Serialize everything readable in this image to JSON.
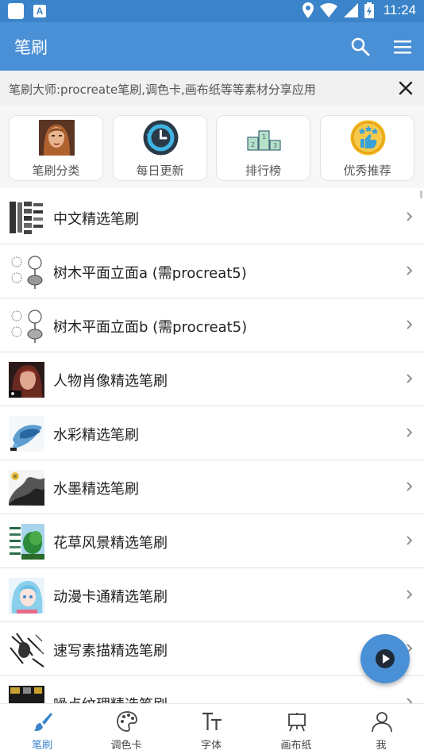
{
  "status_bar": {
    "time": "11:24"
  },
  "app_bar": {
    "title": "笔刷"
  },
  "notice": {
    "text": "笔刷大师:procreate笔刷,调色卡,画布纸等等素材分享应用"
  },
  "categories": [
    {
      "label": "笔刷分类",
      "icon": "portrait-icon"
    },
    {
      "label": "每日更新",
      "icon": "clock-update-icon"
    },
    {
      "label": "排行榜",
      "icon": "podium-icon"
    },
    {
      "label": "优秀推荐",
      "icon": "thumbs-up-stars-icon"
    }
  ],
  "list": [
    {
      "label": "中文精选笔刷",
      "thumb": "brush-strokes-thumb"
    },
    {
      "label": "树木平面立面a (需procreat5)",
      "thumb": "tree-thumb"
    },
    {
      "label": "树木平面立面b (需procreat5)",
      "thumb": "tree-thumb"
    },
    {
      "label": "人物肖像精选笔刷",
      "thumb": "portrait-thumb"
    },
    {
      "label": "水彩精选笔刷",
      "thumb": "watercolor-thumb"
    },
    {
      "label": "水墨精选笔刷",
      "thumb": "ink-wash-thumb"
    },
    {
      "label": "花草风景精选笔刷",
      "thumb": "landscape-thumb"
    },
    {
      "label": "动漫卡通精选笔刷",
      "thumb": "anime-thumb"
    },
    {
      "label": "速写素描精选笔刷",
      "thumb": "sketch-thumb"
    },
    {
      "label": "噪点纹理精选笔刷",
      "thumb": "noise-texture-thumb"
    }
  ],
  "tabs": [
    {
      "label": "笔刷",
      "icon": "brush-icon",
      "active": true
    },
    {
      "label": "调色卡",
      "icon": "palette-icon",
      "active": false
    },
    {
      "label": "字体",
      "icon": "font-icon",
      "active": false
    },
    {
      "label": "画布纸",
      "icon": "easel-icon",
      "active": false
    },
    {
      "label": "我",
      "icon": "person-icon",
      "active": false
    }
  ],
  "colors": {
    "primary": "#4a90d6",
    "status_bar": "#3b84c9",
    "active_tab": "#3b84c9"
  }
}
